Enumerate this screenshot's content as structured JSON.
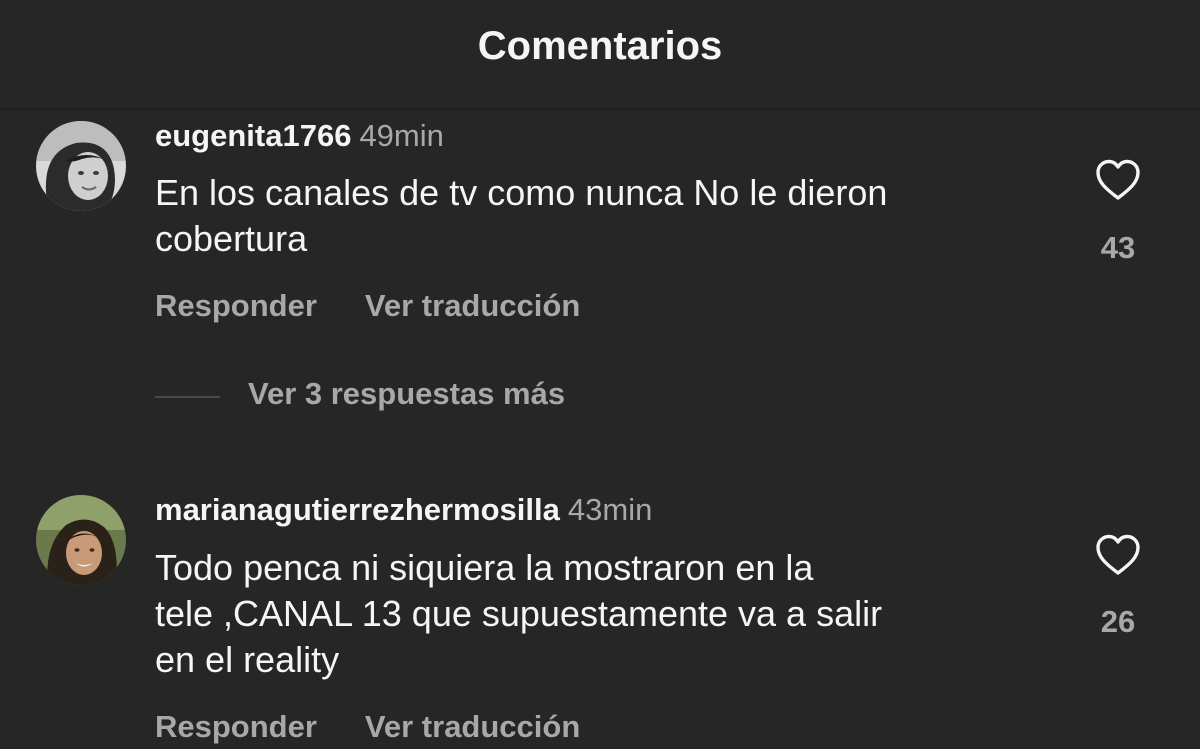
{
  "header": {
    "title": "Comentarios"
  },
  "comments": [
    {
      "username": "eugenita1766",
      "time": "49min",
      "text_line1": "En los canales de tv como nunca No le dieron",
      "text_line2": "cobertura",
      "likes": "43",
      "reply_label": "Responder",
      "translate_label": "Ver traducción",
      "more_replies": "Ver 3 respuestas más",
      "like_icon": "heart-outline-icon"
    },
    {
      "username": "marianagutierrezhermosilla",
      "time": "43min",
      "text_line1": "Todo penca ni siquiera la mostraron en la",
      "text_line2": "tele ,CANAL 13 que supuestamente va a salir",
      "text_line3": "en el reality",
      "likes": "26",
      "reply_label": "Responder",
      "translate_label": "Ver traducción",
      "like_icon": "heart-outline-icon"
    }
  ],
  "colors": {
    "background": "#262626",
    "primary_text": "#f5f5f5",
    "secondary_text": "#a8a8a8"
  }
}
